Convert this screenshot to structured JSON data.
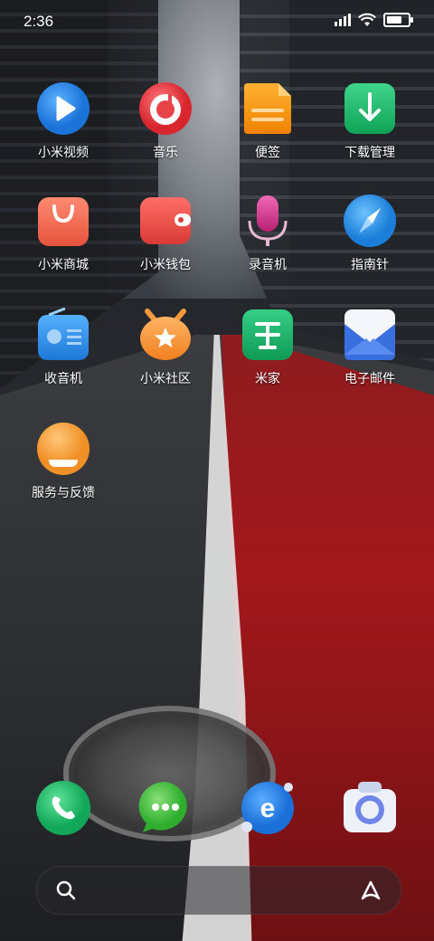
{
  "status_bar": {
    "time": "2:36",
    "battery_level_percent": 90
  },
  "apps": [
    {
      "label": "小米视频",
      "icon": "play-icon",
      "color": "#2f8ef0"
    },
    {
      "label": "音乐",
      "icon": "music-icon",
      "color": "#e9434a"
    },
    {
      "label": "便签",
      "icon": "notes-icon",
      "color": "#f59a12"
    },
    {
      "label": "下载管理",
      "icon": "download-icon",
      "color": "#1fb46a"
    },
    {
      "label": "小米商城",
      "icon": "shopping-bag-icon",
      "color": "#f06b55"
    },
    {
      "label": "小米钱包",
      "icon": "wallet-icon",
      "color": "#ec4f4a"
    },
    {
      "label": "录音机",
      "icon": "microphone-icon",
      "color": "#d8348a"
    },
    {
      "label": "指南针",
      "icon": "compass-icon",
      "color": "#2b9cf0"
    },
    {
      "label": "收音机",
      "icon": "radio-icon",
      "color": "#2f91e6"
    },
    {
      "label": "小米社区",
      "icon": "mi-community-icon",
      "color": "#f59a3c"
    },
    {
      "label": "米家",
      "icon": "mijia-icon",
      "color": "#21b36e"
    },
    {
      "label": "电子邮件",
      "icon": "mail-icon",
      "color": "#3a6fe0"
    },
    {
      "label": "服务与反馈",
      "icon": "feedback-icon",
      "color": "#f5a64a"
    }
  ],
  "dock": [
    {
      "name": "phone",
      "icon": "phone-icon",
      "color": "#1fbf67"
    },
    {
      "name": "messages",
      "icon": "message-icon",
      "color": "#4cc44a"
    },
    {
      "name": "browser",
      "icon": "browser-icon",
      "color": "#2b86f0"
    },
    {
      "name": "camera",
      "icon": "camera-icon",
      "color": "#6f86e8"
    }
  ]
}
